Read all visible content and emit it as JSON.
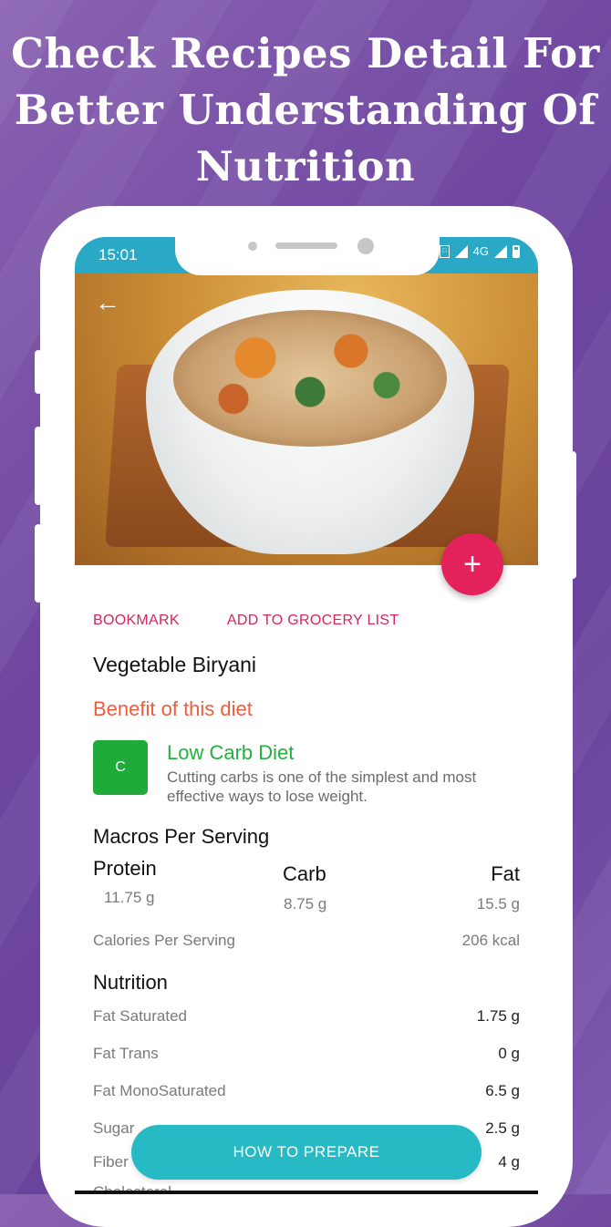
{
  "headline": {
    "line1": "Check Recipes Detail For",
    "line2": "Better Understanding Of",
    "line3": "Nutrition"
  },
  "status_bar": {
    "time": "15:01",
    "network": "4G",
    "icons": [
      "sim-icon",
      "signal-icon",
      "signal-icon",
      "battery-icon"
    ]
  },
  "hero": {
    "image": "vegetable-biryani-photo",
    "back_icon": "arrow-left-icon",
    "fab_label": "+"
  },
  "actions": {
    "bookmark": "BOOKMARK",
    "grocery": "ADD TO GROCERY LIST"
  },
  "recipe": {
    "title": "Vegetable Biryani",
    "benefit_heading": "Benefit of this diet",
    "diet": {
      "badge": "C",
      "name": "Low Carb Diet",
      "description": "Cutting carbs is one of the simplest and most effective ways to lose weight."
    }
  },
  "macros": {
    "heading": "Macros Per Serving",
    "protein_label": "Protein",
    "protein_value": "11.75 g",
    "carb_label": "Carb",
    "carb_value": "8.75 g",
    "fat_label": "Fat",
    "fat_value": "15.5 g",
    "calories_label": "Calories Per Serving",
    "calories_value": "206 kcal"
  },
  "nutrition": {
    "heading": "Nutrition",
    "rows": [
      {
        "label": "Fat Saturated",
        "value": "1.75 g"
      },
      {
        "label": "Fat Trans",
        "value": "0 g"
      },
      {
        "label": "Fat MonoSaturated",
        "value": "6.5 g"
      },
      {
        "label": "Sugar",
        "value": "2.5 g"
      },
      {
        "label": "Fiber",
        "value": "4 g"
      },
      {
        "label": "Cholesterol",
        "value": ""
      }
    ]
  },
  "buttons": {
    "prepare": "HOW TO PREPARE"
  },
  "colors": {
    "background": "#6e46a0",
    "status_bar": "#2aa9c6",
    "accent_pink": "#e3225c",
    "benefit_orange": "#f05c3b",
    "diet_green": "#1faa3a",
    "prepare_teal": "#27b9c4"
  }
}
